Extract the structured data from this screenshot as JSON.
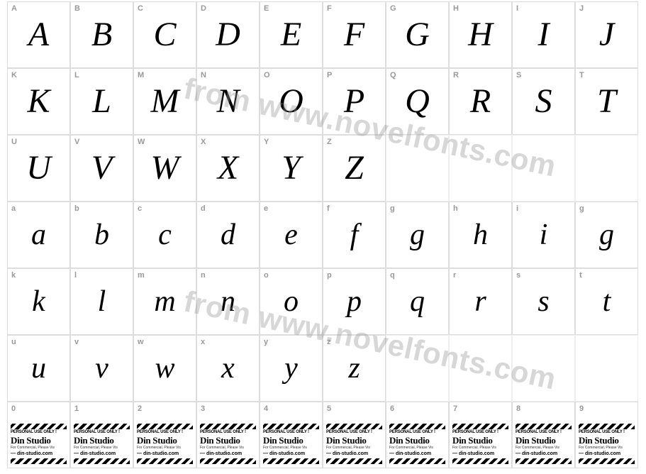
{
  "watermark_text": "from www.novelfonts.com",
  "rows": [
    {
      "type": "upper",
      "cells": [
        {
          "label": "A",
          "glyph": "A"
        },
        {
          "label": "B",
          "glyph": "B"
        },
        {
          "label": "C",
          "glyph": "C"
        },
        {
          "label": "D",
          "glyph": "D"
        },
        {
          "label": "E",
          "glyph": "E"
        },
        {
          "label": "F",
          "glyph": "F"
        },
        {
          "label": "G",
          "glyph": "G"
        },
        {
          "label": "H",
          "glyph": "H"
        },
        {
          "label": "I",
          "glyph": "I"
        },
        {
          "label": "J",
          "glyph": "J"
        }
      ]
    },
    {
      "type": "upper",
      "cells": [
        {
          "label": "K",
          "glyph": "K"
        },
        {
          "label": "L",
          "glyph": "L"
        },
        {
          "label": "M",
          "glyph": "M"
        },
        {
          "label": "N",
          "glyph": "N"
        },
        {
          "label": "O",
          "glyph": "O"
        },
        {
          "label": "P",
          "glyph": "P"
        },
        {
          "label": "Q",
          "glyph": "Q"
        },
        {
          "label": "R",
          "glyph": "R"
        },
        {
          "label": "S",
          "glyph": "S"
        },
        {
          "label": "T",
          "glyph": "T"
        }
      ]
    },
    {
      "type": "upper",
      "cells": [
        {
          "label": "U",
          "glyph": "U"
        },
        {
          "label": "V",
          "glyph": "V"
        },
        {
          "label": "W",
          "glyph": "W"
        },
        {
          "label": "X",
          "glyph": "X"
        },
        {
          "label": "Y",
          "glyph": "Y"
        },
        {
          "label": "Z",
          "glyph": "Z"
        },
        {
          "label": "",
          "glyph": ""
        },
        {
          "label": "",
          "glyph": ""
        },
        {
          "label": "",
          "glyph": ""
        },
        {
          "label": "",
          "glyph": ""
        }
      ]
    },
    {
      "type": "lower",
      "cells": [
        {
          "label": "a",
          "glyph": "a"
        },
        {
          "label": "b",
          "glyph": "b"
        },
        {
          "label": "c",
          "glyph": "c"
        },
        {
          "label": "d",
          "glyph": "d"
        },
        {
          "label": "e",
          "glyph": "e"
        },
        {
          "label": "f",
          "glyph": "f"
        },
        {
          "label": "g",
          "glyph": "g"
        },
        {
          "label": "h",
          "glyph": "h"
        },
        {
          "label": "i",
          "glyph": "i"
        },
        {
          "label": "g",
          "glyph": "g"
        }
      ]
    },
    {
      "type": "lower",
      "cells": [
        {
          "label": "k",
          "glyph": "k"
        },
        {
          "label": "l",
          "glyph": "l"
        },
        {
          "label": "m",
          "glyph": "m"
        },
        {
          "label": "n",
          "glyph": "n"
        },
        {
          "label": "o",
          "glyph": "o"
        },
        {
          "label": "p",
          "glyph": "p"
        },
        {
          "label": "q",
          "glyph": "q"
        },
        {
          "label": "r",
          "glyph": "r"
        },
        {
          "label": "s",
          "glyph": "s"
        },
        {
          "label": "t",
          "glyph": "t"
        }
      ]
    },
    {
      "type": "lower",
      "cells": [
        {
          "label": "u",
          "glyph": "u"
        },
        {
          "label": "v",
          "glyph": "v"
        },
        {
          "label": "w",
          "glyph": "w"
        },
        {
          "label": "x",
          "glyph": "x"
        },
        {
          "label": "y",
          "glyph": "y"
        },
        {
          "label": "z",
          "glyph": "z"
        },
        {
          "label": "",
          "glyph": ""
        },
        {
          "label": "",
          "glyph": ""
        },
        {
          "label": "",
          "glyph": ""
        },
        {
          "label": "",
          "glyph": ""
        }
      ]
    },
    {
      "type": "digit",
      "cells": [
        {
          "label": "0"
        },
        {
          "label": "1"
        },
        {
          "label": "2"
        },
        {
          "label": "3"
        },
        {
          "label": "4"
        },
        {
          "label": "5"
        },
        {
          "label": "6"
        },
        {
          "label": "7"
        },
        {
          "label": "8"
        },
        {
          "label": "9"
        }
      ]
    }
  ],
  "din_studio": {
    "line1": "PERSONAL USE ONLY !",
    "line2": "Din Studio",
    "line3": "For Commercial, Please Vis",
    "line4": "— din-studio.com"
  }
}
